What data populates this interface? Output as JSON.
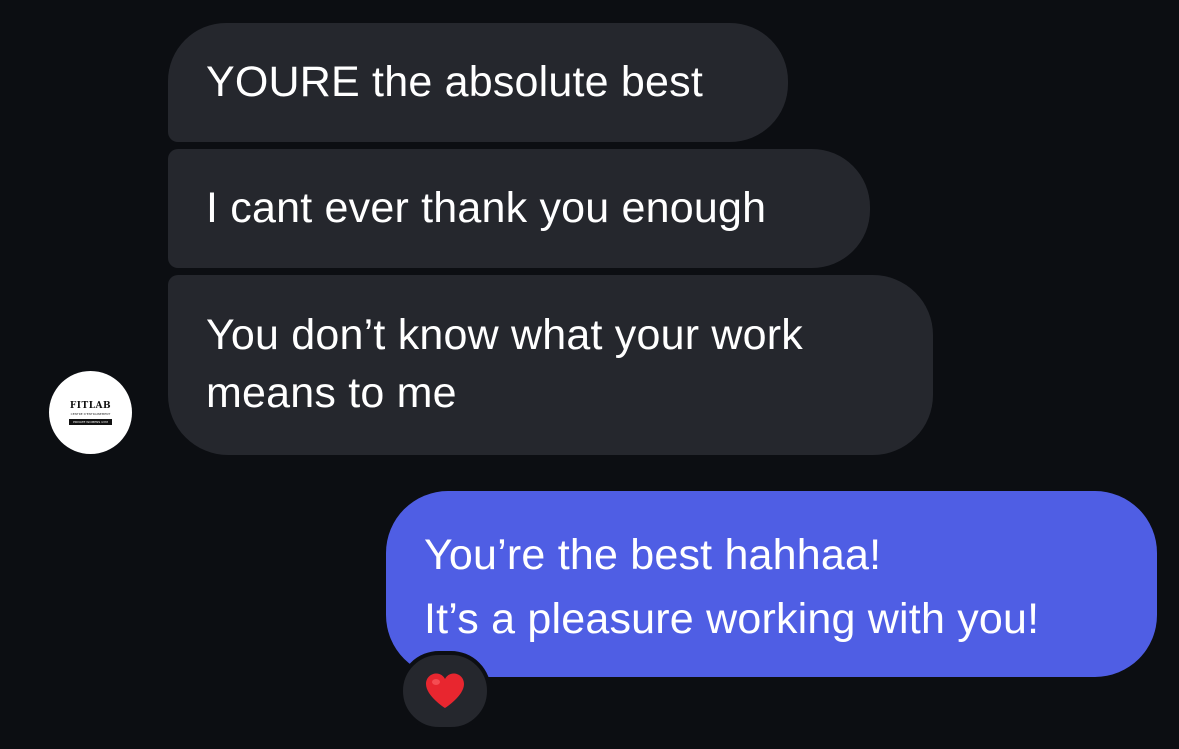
{
  "conversation": {
    "messages": [
      {
        "direction": "incoming",
        "lines": [
          "YOURE the absolute best"
        ]
      },
      {
        "direction": "incoming",
        "lines": [
          "I cant ever thank you enough"
        ]
      },
      {
        "direction": "incoming",
        "lines": [
          "You don’t know what your work",
          "means to me"
        ]
      },
      {
        "direction": "outgoing",
        "lines": [
          "You’re the best hahhaa!",
          "It’s a pleasure working with you!"
        ],
        "reaction": {
          "icon": "red-heart-icon",
          "color": "#e8262f"
        }
      }
    ]
  },
  "sender_avatar": {
    "brand": "FITLAB",
    "tagline": "CENTRE D'ENTRAINEMENT",
    "banner": "PRIVATE WOMENS GYM"
  },
  "colors": {
    "background": "#0c0e12",
    "incoming_bubble": "#25272d",
    "outgoing_bubble": "#4f5ee4",
    "text": "#ffffff"
  }
}
